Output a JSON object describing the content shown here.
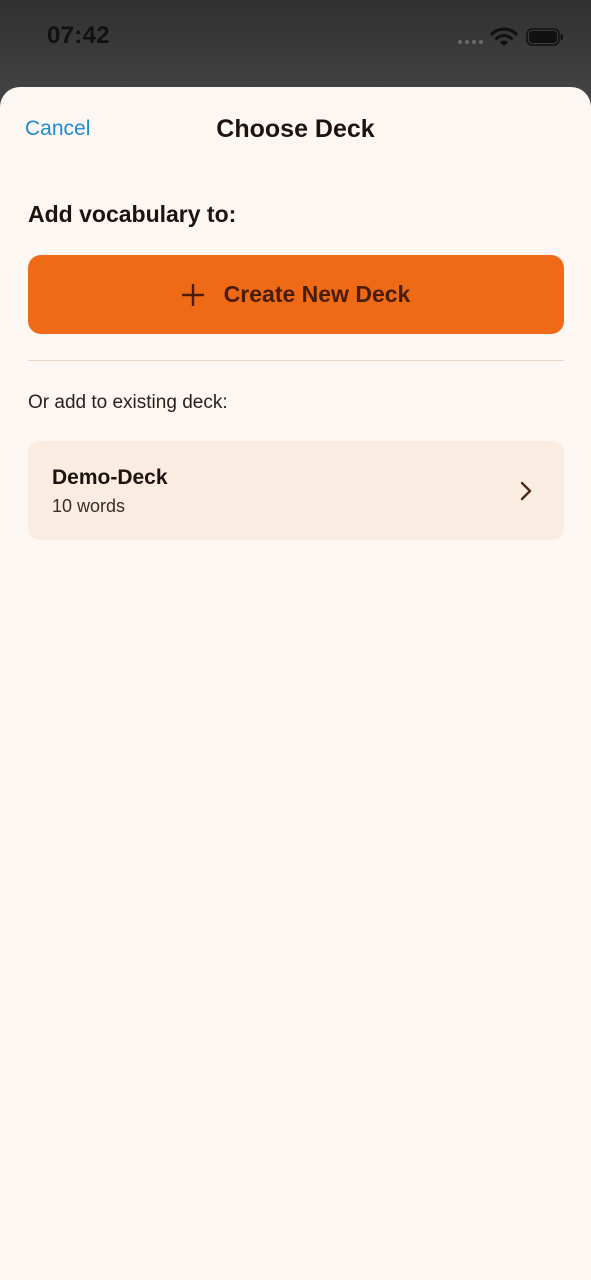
{
  "status_bar": {
    "time": "07:42",
    "icons": [
      "signal-icon",
      "wifi-icon",
      "battery-icon"
    ]
  },
  "nav": {
    "cancel_label": "Cancel",
    "title": "Choose Deck"
  },
  "heading": "Add vocabulary to:",
  "create_button": {
    "icon": "plus-icon",
    "label": "Create New Deck"
  },
  "existing_label": "Or add to existing deck:",
  "decks": [
    {
      "name": "Demo-Deck",
      "count": "10 words",
      "icon": "chevron-right-icon"
    }
  ],
  "colors": {
    "accent": "#ef6a16",
    "link": "#1f8ad1",
    "sheet_background": "#fdf7f3",
    "card_background": "#fbece2"
  }
}
